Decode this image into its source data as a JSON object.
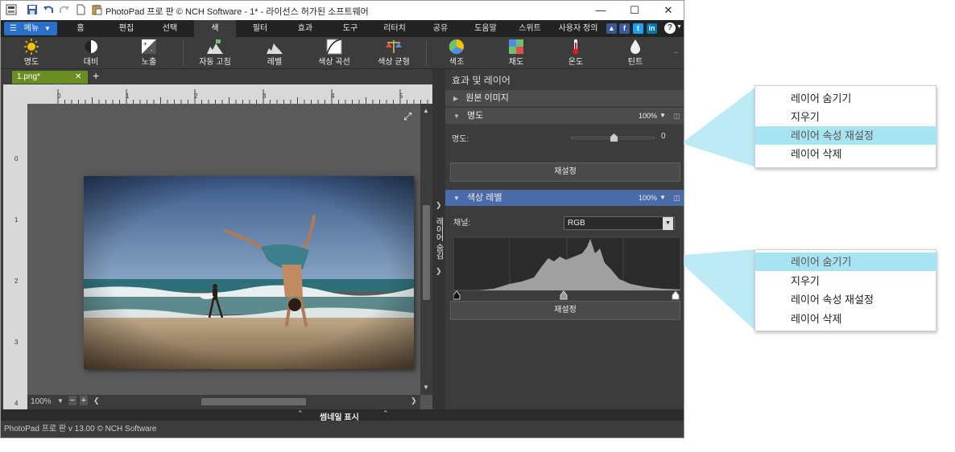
{
  "window": {
    "title": "PhotoPad 프로 판 © NCH Software - 1* - 라이선스 허가된 소프트웨어",
    "controls": [
      "minimize-icon",
      "maximize-icon",
      "close-icon"
    ]
  },
  "tabs": {
    "menu_label": "메뉴",
    "items": [
      "홈",
      "편집",
      "선택",
      "색",
      "필터",
      "효과",
      "도구",
      "리터치",
      "공유",
      "도움말",
      "스위트",
      "사용자 정의"
    ],
    "active": "색"
  },
  "ribbon": {
    "items": [
      "명도",
      "대비",
      "노출",
      "자동 고침",
      "레벨",
      "색상 곡선",
      "색상 균형",
      "색조",
      "채도",
      "온도",
      "틴트"
    ]
  },
  "doc_tab": {
    "name": "1.png*"
  },
  "ruler": {
    "h_ticks": [
      "0",
      "1",
      "2",
      "3",
      "4",
      "5"
    ],
    "v_ticks": [
      "0",
      "1",
      "2",
      "3",
      "4"
    ]
  },
  "canvas": {
    "zoom": "100%"
  },
  "side_tab_label": "레이어 숨김",
  "panel": {
    "title": "효과 및 레이어",
    "original_layer": "원본 이미지",
    "layer1": {
      "name": "명도",
      "opacity": "100%",
      "param_label": "명도:",
      "param_value": "0",
      "slider_fraction": 0.5,
      "reset": "재설정"
    },
    "layer2": {
      "name": "색상 레벨",
      "opacity": "100%",
      "channel_label": "채널:",
      "channel_value": "RGB",
      "reset": "재설정"
    }
  },
  "bottom": {
    "thumbnail_label": "썸네일 표시"
  },
  "status": {
    "text": "PhotoPad 프로 판 v 13.00 © NCH Software"
  },
  "callout1": {
    "items": [
      "레이어 숨기기",
      "지우기",
      "레이어 속성 재설정",
      "레이어 삭제"
    ],
    "highlighted": 2
  },
  "callout2": {
    "items": [
      "레이어 숨기기",
      "지우기",
      "레이어 속성 재설정",
      "레이어 삭제"
    ],
    "highlighted": 0
  },
  "colors": {
    "accent": "#2a6fc9",
    "selected_layer": "#4a6aa8",
    "callout_highlight": "#a7e3f0",
    "doc_tab": "#6b8e23"
  }
}
